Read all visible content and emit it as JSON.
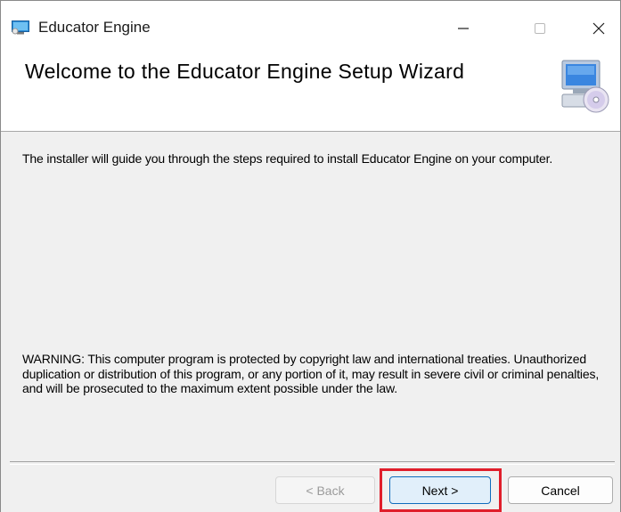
{
  "window": {
    "title": "Educator Engine",
    "controls": {
      "minimize": "—",
      "maximize": "☐",
      "close": "✕"
    },
    "icon": "installer-app-icon"
  },
  "banner": {
    "title": "Welcome to the Educator Engine Setup Wizard",
    "art_icon": "computer-with-disc-icon"
  },
  "body": {
    "intro": "The installer will guide you through the steps required to install Educator Engine on your computer.",
    "warning": "WARNING: This computer program is protected by copyright law and international treaties. Unauthorized duplication or distribution of this program, or any portion of it, may result in severe civil or criminal penalties, and will be prosecuted to the maximum extent possible under the law."
  },
  "buttons": {
    "back": "< Back",
    "next": "Next >",
    "cancel": "Cancel"
  },
  "colors": {
    "highlight": "#e01e2b",
    "accent": "#0f6cbd",
    "dialog_bg": "#f0f0f0"
  }
}
